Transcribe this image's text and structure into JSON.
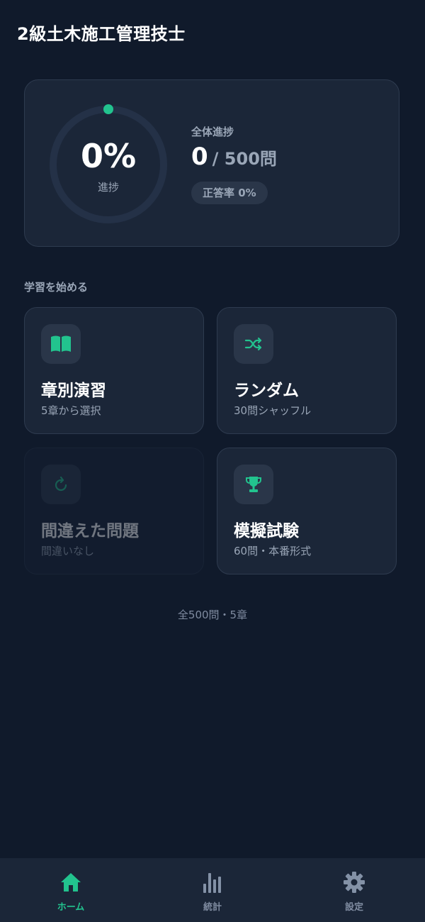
{
  "app": {
    "title": "2級土木施工管理技士"
  },
  "progress": {
    "percent_label": "0%",
    "ring_label": "進捗",
    "ring_fraction": 0,
    "overall_label": "全体進捗",
    "answered": "0",
    "total_label": "/ 500問",
    "accuracy_label": "正答率 0%"
  },
  "section": {
    "heading": "学習を始める"
  },
  "modes": [
    {
      "title": "章別演習",
      "subtitle": "5章から選択",
      "icon": "book-icon",
      "enabled": true
    },
    {
      "title": "ランダム",
      "subtitle": "30問シャッフル",
      "icon": "shuffle-icon",
      "enabled": true
    },
    {
      "title": "間違えた問題",
      "subtitle": "間違いなし",
      "icon": "refresh-icon",
      "enabled": false
    },
    {
      "title": "模擬試験",
      "subtitle": "60問・本番形式",
      "icon": "trophy-icon",
      "enabled": true
    }
  ],
  "footer": {
    "note": "全500問・5章"
  },
  "nav": {
    "items": [
      {
        "label": "ホーム",
        "icon": "home-icon",
        "active": true
      },
      {
        "label": "統計",
        "icon": "bar-chart-icon",
        "active": false
      },
      {
        "label": "設定",
        "icon": "gear-icon",
        "active": false
      }
    ]
  },
  "colors": {
    "background": "#101a2b",
    "card": "#1b2638",
    "accent": "#22c38e",
    "muted_text": "#9aa6b7"
  }
}
